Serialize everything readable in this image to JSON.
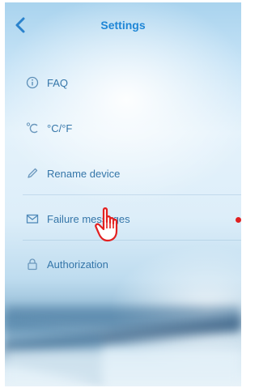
{
  "header": {
    "title": "Settings",
    "back_icon": "chevron-left-icon"
  },
  "menu": {
    "items": [
      {
        "label": "FAQ",
        "icon": "info-circle-icon"
      },
      {
        "label": "°C/°F",
        "icon": "temperature-c-icon"
      },
      {
        "label": "Rename device",
        "icon": "pencil-icon"
      },
      {
        "label": "Failure messages",
        "icon": "envelope-icon",
        "badge_color": "#e02020"
      },
      {
        "label": "Authorization",
        "icon": "lock-icon"
      }
    ]
  },
  "pointer": {
    "icon": "hand-pointer-icon"
  },
  "colors": {
    "accent": "#1f86d6",
    "item_text": "#3576a9",
    "badge": "#e02020"
  }
}
